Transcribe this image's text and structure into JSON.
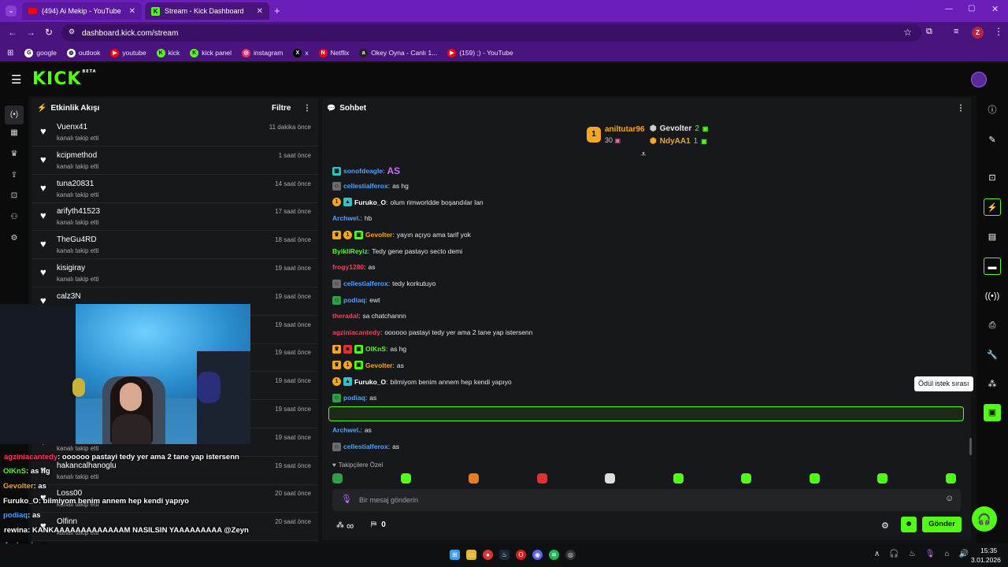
{
  "browser": {
    "tabs": [
      {
        "title": "(494) Ai Mekip - YouTube"
      },
      {
        "title": "Stream - Kick Dashboard"
      }
    ],
    "url": "dashboard.kick.com/stream",
    "profile_letter": "Z",
    "bookmarks": [
      {
        "label": "google",
        "icon": "google-icon",
        "color": "#ffffff"
      },
      {
        "label": "outlook",
        "icon": "globe-icon",
        "color": "#ffffff"
      },
      {
        "label": "youtube",
        "icon": "youtube-icon",
        "color": "#ff0000"
      },
      {
        "label": "kick",
        "icon": "kick-icon",
        "color": "#53fc18"
      },
      {
        "label": "kick panel",
        "icon": "kick-icon",
        "color": "#53fc18"
      },
      {
        "label": "instagram",
        "icon": "instagram-icon",
        "color": "#e1306c"
      },
      {
        "label": "x",
        "icon": "x-icon",
        "color": "#000000"
      },
      {
        "label": "Netflix",
        "icon": "netflix-icon",
        "color": "#e50914"
      },
      {
        "label": "Okey Oyna - Canlı 1...",
        "icon": "okey-icon",
        "color": "#222222"
      },
      {
        "label": "(159) ;) - YouTube",
        "icon": "youtube-icon",
        "color": "#ff0000"
      }
    ]
  },
  "app": {
    "logo": "KICK",
    "logo_sup": "BETA"
  },
  "activity": {
    "title": "Etkinlik Akışı",
    "filter_label": "Filtre",
    "items": [
      {
        "name": "Vuenx41",
        "sub": "kanalı takip etti",
        "time": "11 dakika önce"
      },
      {
        "name": "kcipmethod",
        "sub": "kanalı takip etti",
        "time": "1 saat önce"
      },
      {
        "name": "tuna20831",
        "sub": "kanalı takip etti",
        "time": "14 saat önce"
      },
      {
        "name": "arifyth41523",
        "sub": "kanalı takip etti",
        "time": "17 saat önce"
      },
      {
        "name": "TheGu4RD",
        "sub": "kanalı takip etti",
        "time": "18 saat önce"
      },
      {
        "name": "kisigiray",
        "sub": "kanalı takip etti",
        "time": "19 saat önce"
      },
      {
        "name": "calz3N",
        "sub": "kanalı takip etti",
        "time": "19 saat önce"
      },
      {
        "name": "",
        "sub": "",
        "time": "19 saat önce"
      },
      {
        "name": "",
        "sub": "",
        "time": "19 saat önce"
      },
      {
        "name": "",
        "sub": "",
        "time": "19 saat önce"
      },
      {
        "name": "",
        "sub": "",
        "time": "19 saat önce"
      },
      {
        "name": "",
        "sub": "kanalı takip etti",
        "time": "19 saat önce"
      },
      {
        "name": "hakancalhanoglu",
        "sub": "kanalı takip etti",
        "time": "19 saat önce"
      },
      {
        "name": "Loss00",
        "sub": "kanalı takip etti",
        "time": "20 saat önce"
      },
      {
        "name": "Olfinn",
        "sub": "kanalı takip etti",
        "time": "20 saat önce"
      }
    ]
  },
  "overlay_chat": [
    {
      "user": "agziniacantedy",
      "text": ": oooooo pastayi tedy yer ama 2 tane yap istersenn",
      "color": "#ff3b5c"
    },
    {
      "user": "OlKnS",
      "text": ": as hg",
      "color": "#53fc18"
    },
    {
      "user": "Gevolter",
      "text": ": as",
      "color": "#f5a623"
    },
    {
      "user": "Furuko_O",
      "text": ": bilmiyom benim annem hep kendi yapıyo",
      "color": "#ffffff"
    },
    {
      "user": "podiaq",
      "text": ": as",
      "color": "#4aa3ff"
    },
    {
      "user": "rewina",
      "text": ": KANKAAAAAAAAAAAAAM NASILSIN YAAAAAAAAA @Zeyn",
      "color": "#ffffff"
    },
    {
      "user": "Archwel.",
      "text": ": as",
      "color": "#4aa3ff"
    },
    {
      "user": "cellestialferox",
      "text": ": as",
      "color": "#4aa3ff"
    }
  ],
  "chat": {
    "title": "Sohbet",
    "top_gifters": [
      {
        "rank": "1",
        "name": "aniltutar96",
        "count": "30"
      },
      {
        "name": "Gevolter",
        "count": "2"
      },
      {
        "name": "NdyAA1",
        "count": "1"
      }
    ],
    "messages": [
      {
        "user": "sonofdeagle",
        "text": "AS",
        "color": "#4aa3ff"
      },
      {
        "user": "cellestialferox",
        "text": "as hg",
        "color": "#4aa3ff"
      },
      {
        "user": "Furuko_O",
        "text": "olum rimworldde boşandılar lan",
        "color": "#ffffff"
      },
      {
        "user": "Archwel.",
        "text": "hb",
        "color": "#4aa3ff"
      },
      {
        "user": "Gevolter",
        "text": "yayın açıyo ama tarif yok",
        "color": "#f5a623"
      },
      {
        "user": "ByikliReyiz",
        "text": "Tedy gene pastayo secto demi",
        "color": "#53fc18"
      },
      {
        "user": "frogy1280",
        "text": "as",
        "color": "#ff3b5c"
      },
      {
        "user": "cellestialferox",
        "text": "tedy korkutuyo",
        "color": "#4aa3ff"
      },
      {
        "user": "podiaq",
        "text": "ewt",
        "color": "#4aa3ff"
      },
      {
        "user": "theradal",
        "text": "sa chatchannn",
        "color": "#ff3b5c"
      },
      {
        "user": "agziniacantedy",
        "text": "oooooo pastayi tedy yer ama 2 tane yap istersenn",
        "color": "#ff3b5c"
      },
      {
        "user": "OlKnS",
        "text": "as hg",
        "color": "#53fc18"
      },
      {
        "user": "Gevolter",
        "text": "as",
        "color": "#f5a623"
      },
      {
        "user": "Furuko_O",
        "text": "bilmiyom benim annem hep kendi yapıyo",
        "color": "#ffffff"
      },
      {
        "user": "podiaq",
        "text": "as",
        "color": "#4aa3ff"
      },
      {
        "user": "rewina",
        "text": "KANKAAAAAAAAAAAAAM NASILSIN YAAAAAAAAA @Zeyn",
        "color": "#ffffff"
      },
      {
        "user": "Archwel.",
        "text": "as",
        "color": "#4aa3ff"
      },
      {
        "user": "cellestialferox",
        "text": "as",
        "color": "#4aa3ff"
      }
    ],
    "followers_label": "Takipçilere Özel",
    "input_placeholder": "Bir mesaj gönderin",
    "points_symbol": "∞",
    "shop_count": "0",
    "send_label": "Gönder"
  },
  "tooltip": "Ödül istek sırası",
  "taskbar": {
    "time": "15:35",
    "date": "3.01.2026"
  },
  "colors": {
    "accent": "#53fc18",
    "panel": "#17181b",
    "tabbar": "#6b1fb8"
  }
}
